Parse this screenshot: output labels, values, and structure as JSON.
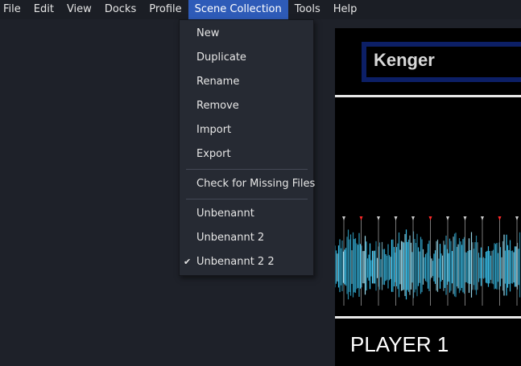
{
  "menubar": {
    "items": [
      "File",
      "Edit",
      "View",
      "Docks",
      "Profile",
      "Scene Collection",
      "Tools",
      "Help"
    ],
    "active_index": 5
  },
  "dropdown": {
    "group1": [
      "New",
      "Duplicate",
      "Rename",
      "Remove",
      "Import",
      "Export"
    ],
    "group2": [
      "Check for Missing Files"
    ],
    "group3": [
      "Unbenannt",
      "Unbenannt 2",
      "Unbenannt 2 2"
    ],
    "checked_item": "Unbenannt 2 2",
    "check_icon": "checkmark-icon"
  },
  "preview": {
    "title_text": "Kenger",
    "player_label": "PLAYER 1"
  },
  "colors": {
    "menubar_bg": "#1b1e25",
    "active_menu_bg": "#2e5bb8",
    "dropdown_bg": "#262a33",
    "title_frame": "#0c1f66",
    "waveform_cyan": "#3fd0ff",
    "marker_red": "#ff2a2a"
  }
}
